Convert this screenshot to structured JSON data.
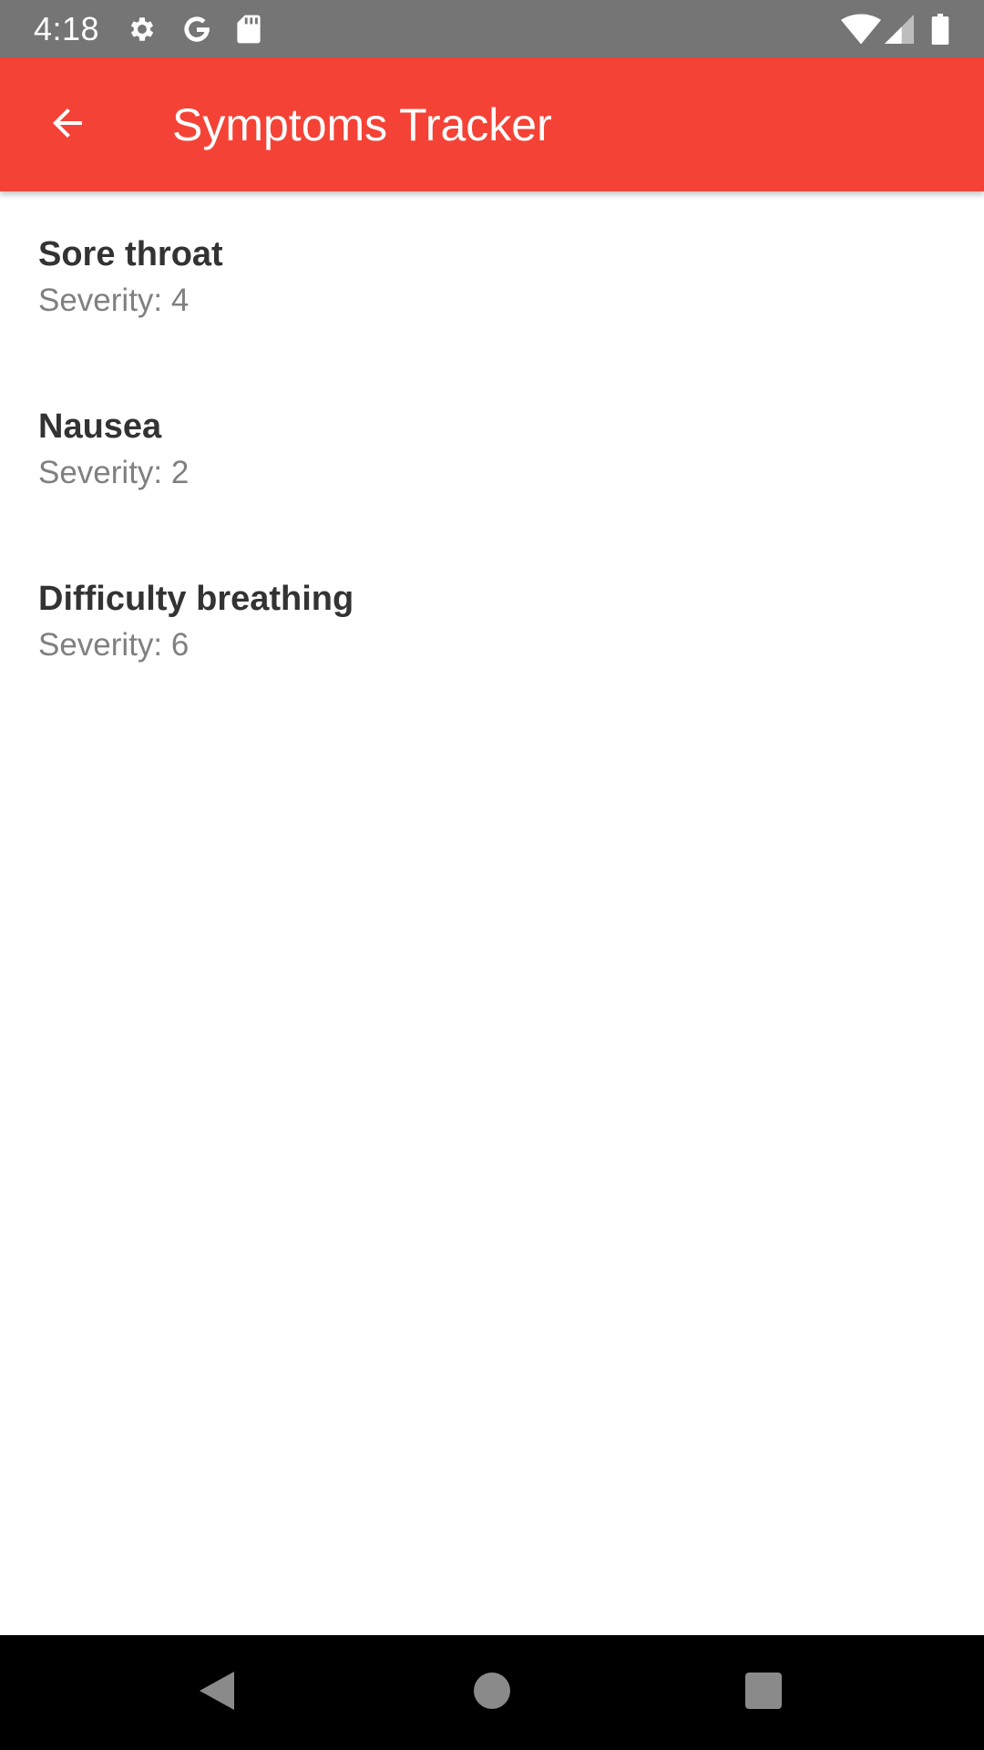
{
  "status_bar": {
    "time": "4:18",
    "left_icons": [
      "gear-icon",
      "google-icon",
      "sd-card-icon"
    ],
    "right_icons": [
      "wifi-icon",
      "signal-icon",
      "battery-icon"
    ]
  },
  "app_bar": {
    "title": "Symptoms Tracker",
    "background_color": "#f44336",
    "back_icon": "arrow-back-icon"
  },
  "symptoms": [
    {
      "name": "Sore throat",
      "severity": "Severity: 4"
    },
    {
      "name": "Nausea",
      "severity": "Severity: 2"
    },
    {
      "name": "Difficulty breathing",
      "severity": "Severity: 6"
    }
  ],
  "nav_bar": {
    "buttons": [
      "back-triangle-icon",
      "home-circle-icon",
      "recents-square-icon"
    ]
  }
}
